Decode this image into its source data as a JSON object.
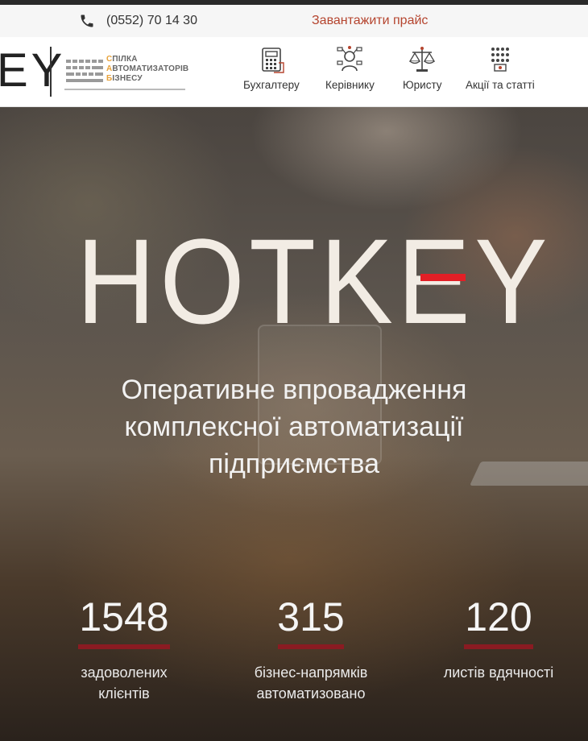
{
  "topbar": {
    "phone": "(0552) 70 14 30",
    "download_price": "Завантажити прайс",
    "phone_icon": "phone-icon"
  },
  "header": {
    "logo_fragment": "EY",
    "association": {
      "line1_first": "С",
      "line1_rest": "ПІЛКА",
      "line2_first": "А",
      "line2_rest": "ВТОМАТИЗАТОРІВ",
      "line3_first": "Б",
      "line3_rest": "ІЗНЕСУ"
    },
    "nav": [
      {
        "label": "Бухгалтеру",
        "icon": "calculator-icon"
      },
      {
        "label": "Керівнику",
        "icon": "manager-icon"
      },
      {
        "label": "Юристу",
        "icon": "scales-icon"
      },
      {
        "label": "Акції та статті",
        "icon": "audience-icon"
      }
    ]
  },
  "hero": {
    "brand": "HOTKEY",
    "tagline_lines": [
      "Оперативне впровадження",
      "комплексної автоматизації",
      "підприємства"
    ],
    "stats": [
      {
        "value": "1548",
        "label_lines": [
          "задоволених",
          "клієнтів"
        ]
      },
      {
        "value": "315",
        "label_lines": [
          "бізнес-напрямків",
          "автоматизовано"
        ]
      },
      {
        "value": "120",
        "label_lines": [
          "листів вдячності"
        ]
      }
    ]
  },
  "colors": {
    "accent_red": "#e21f26",
    "stat_bar": "#8a1b22",
    "link": "#b5452f"
  }
}
